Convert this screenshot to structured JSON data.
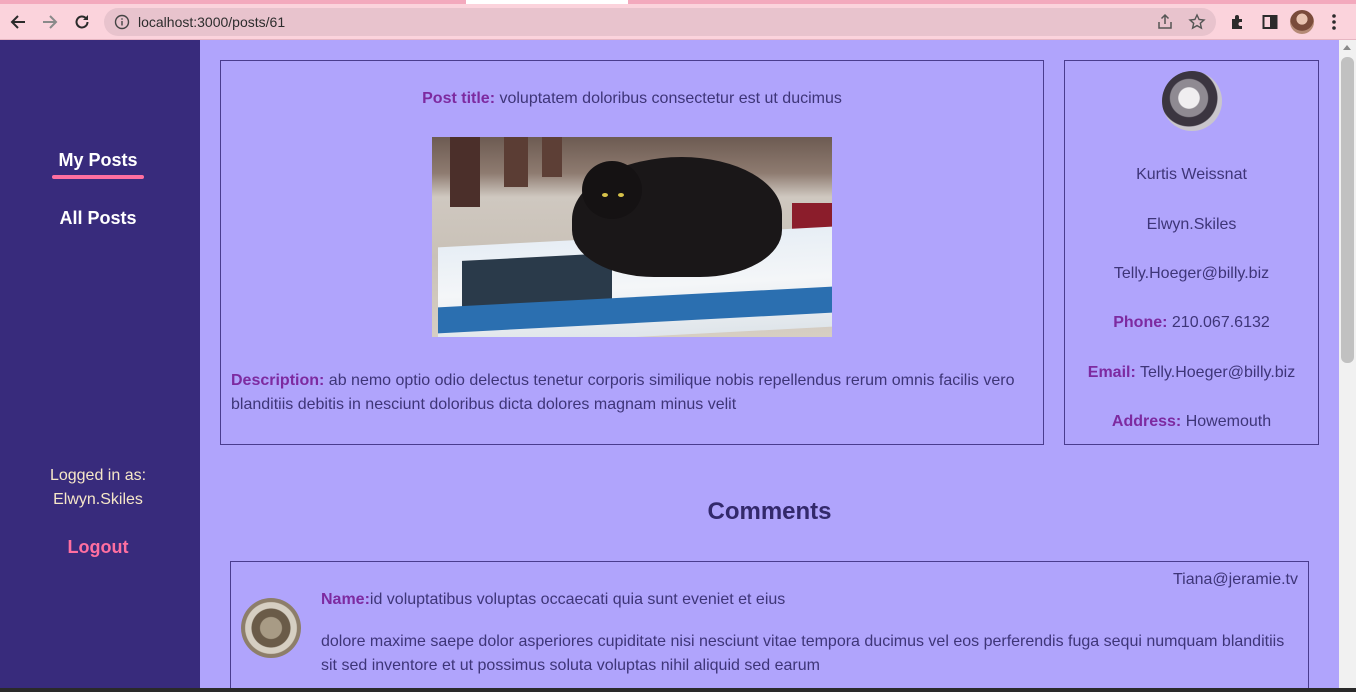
{
  "browser": {
    "url": "localhost:3000/posts/61"
  },
  "sidebar": {
    "my_posts": "My Posts",
    "all_posts": "All Posts",
    "logged_in_label": "Logged in as:",
    "logged_in_user": "Elwyn.Skiles",
    "logout": "Logout"
  },
  "post": {
    "title_label": "Post title:",
    "title": "voluptatem doloribus consectetur est ut ducimus",
    "description_label": "Description:",
    "description": "ab nemo optio odio delectus tenetur corporis similique nobis repellendus rerum omnis facilis vero blanditiis debitis in nesciunt doloribus dicta dolores magnam minus velit"
  },
  "author": {
    "full_name": "Kurtis Weissnat",
    "username": "Elwyn.Skiles",
    "email_plain": "Telly.Hoeger@billy.biz",
    "phone_label": "Phone:",
    "phone": "210.067.6132",
    "email_label": "Email:",
    "email": "Telly.Hoeger@billy.biz",
    "address_label": "Address:",
    "address": "Howemouth"
  },
  "comments": {
    "heading": "Comments",
    "items": [
      {
        "email": "Tiana@jeramie.tv",
        "name_label": "Name:",
        "name": "id voluptatibus voluptas occaecati quia sunt eveniet et eius",
        "body": "dolore maxime saepe dolor asperiores cupiditate nisi nesciunt vitae tempora ducimus vel eos perferendis fuga sequi numquam blanditiis sit sed inventore et ut possimus soluta voluptas nihil aliquid sed earum"
      }
    ]
  },
  "colors": {
    "sidebar_bg": "#382b7c",
    "page_bg": "#b0a4fc",
    "accent_pink": "#ff6fa0",
    "label_purple": "#7d2aa0"
  }
}
